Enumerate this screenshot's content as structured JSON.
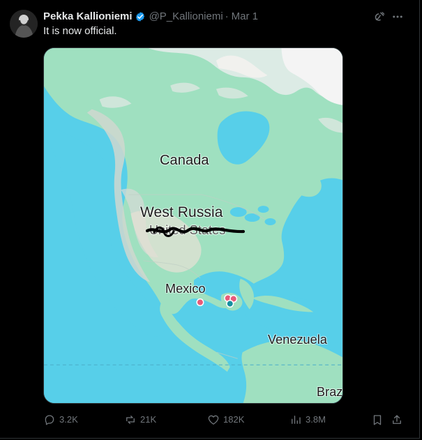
{
  "tweet": {
    "author": {
      "display_name": "Pekka Kallioniemi",
      "handle": "@P_Kallioniemi",
      "verified_icon": "verified-badge-icon"
    },
    "separator": "·",
    "date": "Mar 1",
    "text": "It is now official."
  },
  "map": {
    "labels": {
      "canada": "Canada",
      "west_russia": "West Russia",
      "united_states_struck": "United States",
      "mexico": "Mexico",
      "venezuela": "Venezuela",
      "brazil_partial": "Braz"
    },
    "colors": {
      "water": "#57cfe9",
      "land": "#9fe0c0",
      "mountain": "#cfd7cf",
      "ice": "#f4f4f4",
      "marker_red": "#e85b7a",
      "marker_teal": "#168fa0"
    }
  },
  "actions": {
    "reply_count": "3.2K",
    "repost_count": "21K",
    "like_count": "182K",
    "view_count": "3.8M"
  },
  "icons": {
    "reply": "reply-icon",
    "repost": "repost-icon",
    "like": "heart-icon",
    "views": "views-icon",
    "bookmark": "bookmark-icon",
    "share": "share-icon",
    "grok": "grok-icon",
    "more": "more-icon"
  },
  "theme": {
    "background": "#000000",
    "primary_text": "#e7e9ea",
    "secondary_text": "#71767b",
    "verified": "#1d9bf0"
  }
}
